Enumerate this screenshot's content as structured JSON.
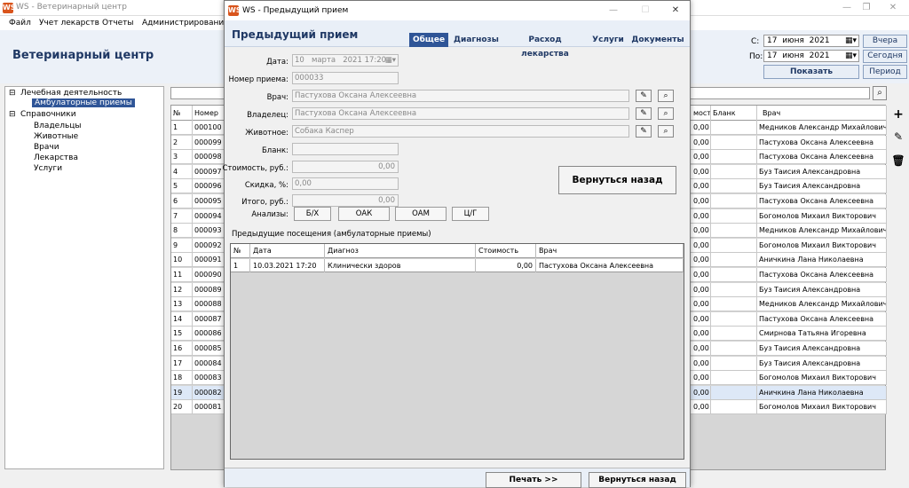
{
  "window": {
    "title": "WS - Ветеринарный центр",
    "app_icon": "WS"
  },
  "menu": [
    "Файл",
    "Учет лекарств",
    "Отчеты",
    "Администрирование"
  ],
  "header": {
    "app_name": "Ветеринарный центр",
    "from_label": "С:",
    "from_day": "17",
    "from_month": "июня",
    "from_year": "2021",
    "to_label": "По:",
    "to_day": "17",
    "to_month": "июня",
    "to_year": "2021",
    "btn_yesterday": "Вчера",
    "btn_today": "Сегодня",
    "btn_show": "Показать",
    "btn_period": "Период"
  },
  "tree": {
    "root1": "Лечебная деятельность",
    "child1": "Амбулаторные приемы",
    "root2": "Справочники",
    "children2": [
      "Владельцы",
      "Животные",
      "Врачи",
      "Лекарства",
      "Услуги"
    ]
  },
  "grid": {
    "headers": {
      "num": "№",
      "nomer": "Номер",
      "cost": "мость",
      "blank": "Бланк",
      "doctor": "Врач"
    },
    "rows": [
      {
        "n": "1",
        "id": "000100",
        "cost": "0,00",
        "doc": "Медников Александр Михайлович"
      },
      {
        "n": "2",
        "id": "000099",
        "cost": "0,00",
        "doc": "Пастухова Оксана Алексеевна"
      },
      {
        "n": "3",
        "id": "000098",
        "cost": "0,00",
        "doc": "Пастухова Оксана Алексеевна"
      },
      {
        "n": "4",
        "id": "000097",
        "cost": "0,00",
        "doc": "Буз Таисия Александровна"
      },
      {
        "n": "5",
        "id": "000096",
        "cost": "0,00",
        "doc": "Буз Таисия Александровна"
      },
      {
        "n": "6",
        "id": "000095",
        "cost": "0,00",
        "doc": "Пастухова Оксана Алексеевна"
      },
      {
        "n": "7",
        "id": "000094",
        "cost": "0,00",
        "doc": "Богомолов Михаил Викторович"
      },
      {
        "n": "8",
        "id": "000093",
        "cost": "0,00",
        "doc": "Медников Александр Михайлович"
      },
      {
        "n": "9",
        "id": "000092",
        "cost": "0,00",
        "doc": "Богомолов Михаил Викторович"
      },
      {
        "n": "10",
        "id": "000091",
        "cost": "0,00",
        "doc": "Аничкина Лана Николаевна"
      },
      {
        "n": "11",
        "id": "000090",
        "cost": "0,00",
        "doc": "Пастухова Оксана Алексеевна"
      },
      {
        "n": "12",
        "id": "000089",
        "cost": "0,00",
        "doc": "Буз Таисия Александровна"
      },
      {
        "n": "13",
        "id": "000088",
        "cost": "0,00",
        "doc": "Медников Александр Михайлович"
      },
      {
        "n": "14",
        "id": "000087",
        "cost": "0,00",
        "doc": "Пастухова Оксана Алексеевна"
      },
      {
        "n": "15",
        "id": "000086",
        "cost": "0,00",
        "doc": "Смирнова Татьяна Игоревна"
      },
      {
        "n": "16",
        "id": "000085",
        "cost": "0,00",
        "doc": "Буз Таисия Александровна"
      },
      {
        "n": "17",
        "id": "000084",
        "cost": "0,00",
        "doc": "Буз Таисия Александровна"
      },
      {
        "n": "18",
        "id": "000083",
        "cost": "0,00",
        "doc": "Богомолов Михаил Викторович"
      },
      {
        "n": "19",
        "id": "000082",
        "cost": "0,00",
        "doc": "Аничкина Лана Николаевна"
      },
      {
        "n": "20",
        "id": "000081",
        "cost": "0,00",
        "doc": "Богомолов Михаил Викторович"
      }
    ]
  },
  "modal": {
    "title": "WS - Предыдущий прием",
    "heading": "Предыдущий прием",
    "tabs": [
      "Общее",
      "Диагнозы",
      "Расход лекарства",
      "Услуги",
      "Документы"
    ],
    "labels": {
      "date": "Дата:",
      "number": "Номер приема:",
      "doctor": "Врач:",
      "owner": "Владелец:",
      "animal": "Животное:",
      "blank": "Бланк:",
      "cost": "Стоимость, руб.:",
      "discount": "Скидка, %:",
      "total": "Итого, руб.:",
      "analyses": "Анализы:"
    },
    "values": {
      "date_day": "10",
      "date_month": "марта",
      "date_rest": "2021 17:20",
      "number": "000033",
      "doctor": "Пастухова Оксана Алексеевна",
      "owner": "Пастухова Оксана Алексеевна",
      "animal": "Собака Каспер",
      "blank": "",
      "cost": "0,00",
      "discount": "0,00",
      "total": "0,00"
    },
    "analysis_buttons": [
      "Б/Х",
      "ОАК",
      "ОАМ",
      "Ц/Г"
    ],
    "back_big": "Вернуться назад",
    "prev_label": "Предыдущие посещения (амбулаторные приемы)",
    "visits_headers": [
      "№",
      "Дата",
      "Диагноз",
      "Стоимость",
      "Врач"
    ],
    "visits": [
      {
        "n": "1",
        "date": "10.03.2021 17:20",
        "diag": "Клинически здоров",
        "cost": "0,00",
        "doc": "Пастухова Оксана Алексеевна"
      }
    ],
    "print_btn": "Печать  >>",
    "back_btn": "Вернуться назад"
  }
}
